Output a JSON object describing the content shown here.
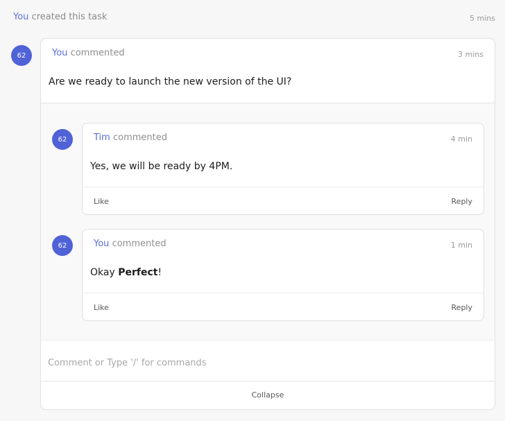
{
  "activity": {
    "actor": "You",
    "action": "created this task",
    "time": "5 mins"
  },
  "comment": {
    "avatar": "62",
    "author": "You",
    "action": "commented",
    "time": "3 mins",
    "text": "Are we ready to launch the new version of the UI?"
  },
  "replies": [
    {
      "avatar": "62",
      "author": "Tim",
      "action": "commented",
      "time": "4 min",
      "text": "Yes, we will be ready by 4PM.",
      "like_label": "Like",
      "reply_label": "Reply"
    },
    {
      "avatar": "62",
      "author": "You",
      "action": "commented",
      "time": "1 min",
      "text_prefix": "Okay ",
      "text_bold": "Perfect",
      "text_suffix": "!",
      "like_label": "Like",
      "reply_label": "Reply"
    }
  ],
  "composer": {
    "placeholder": "Comment or Type '/' for commands",
    "value": ""
  },
  "collapse_label": "Collapse",
  "colors": {
    "accent": "#5b6ed8",
    "avatar_bg": "#4f62d6"
  }
}
